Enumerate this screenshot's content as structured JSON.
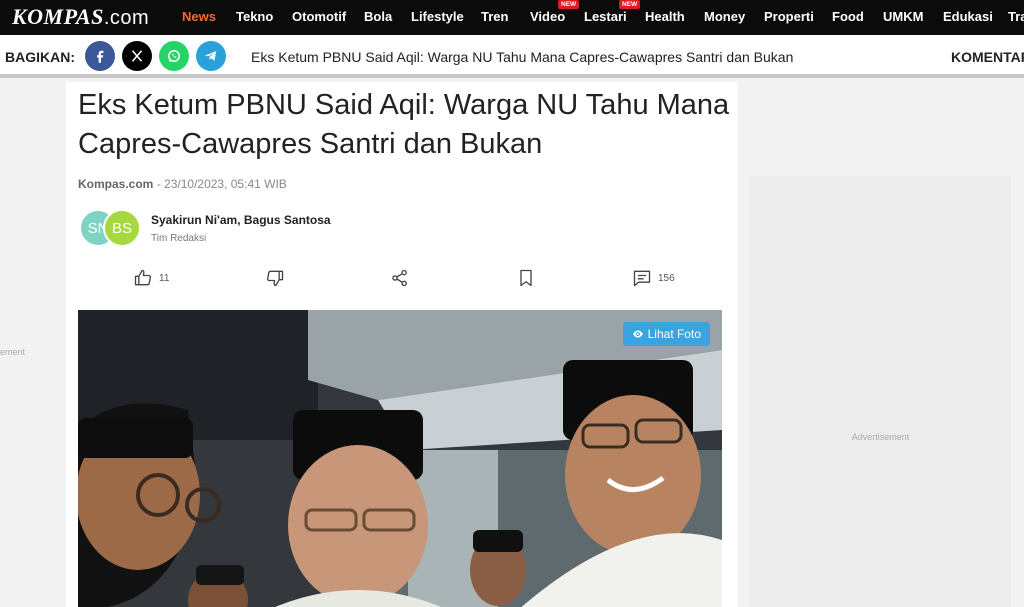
{
  "site": {
    "logo_main": "KOMPAS",
    "logo_suffix": ".com"
  },
  "nav": {
    "items": [
      {
        "label": "News",
        "active": true
      },
      {
        "label": "Tekno"
      },
      {
        "label": "Otomotif"
      },
      {
        "label": "Bola"
      },
      {
        "label": "Lifestyle"
      },
      {
        "label": "Tren"
      },
      {
        "label": "Video",
        "badge": "NEW"
      },
      {
        "label": "Lestari",
        "badge": "NEW"
      },
      {
        "label": "Health"
      },
      {
        "label": "Money"
      },
      {
        "label": "Properti"
      },
      {
        "label": "Food"
      },
      {
        "label": "UMKM"
      },
      {
        "label": "Edukasi"
      },
      {
        "label": "Tra"
      }
    ]
  },
  "share": {
    "label": "BAGIKAN:",
    "networks": [
      "facebook-icon",
      "x-icon",
      "whatsapp-icon",
      "telegram-icon"
    ],
    "title": "Eks Ketum PBNU Said Aqil: Warga NU Tahu Mana Capres-Cawapres Santri dan Bukan",
    "comments_label": "KOMENTAR"
  },
  "left_ad": {
    "label": "ement"
  },
  "article": {
    "title": "Eks Ketum PBNU Said Aqil: Warga NU Tahu Mana Capres-Cawapres Santri dan Bukan",
    "source": "Kompas.com",
    "datetime": "- 23/10/2023, 05:41 WIB",
    "avatars": [
      {
        "initials": "SN",
        "color": "#7fd3c4"
      },
      {
        "initials": "BS",
        "color": "#a6d93f"
      }
    ],
    "authors": "Syakirun Ni'am, Bagus Santosa",
    "team": "Tim Redaksi",
    "actions": {
      "like_count": "11",
      "comment_count": "156"
    },
    "photo_button": "Lihat Foto"
  },
  "right_ad": {
    "label": "Advertisement"
  },
  "colors": {
    "accent": "#f26a2e",
    "photo_button": "#3aa3e0",
    "facebook": "#3b5998",
    "x": "#000000",
    "whatsapp": "#25d366",
    "telegram": "#2aa1da"
  }
}
